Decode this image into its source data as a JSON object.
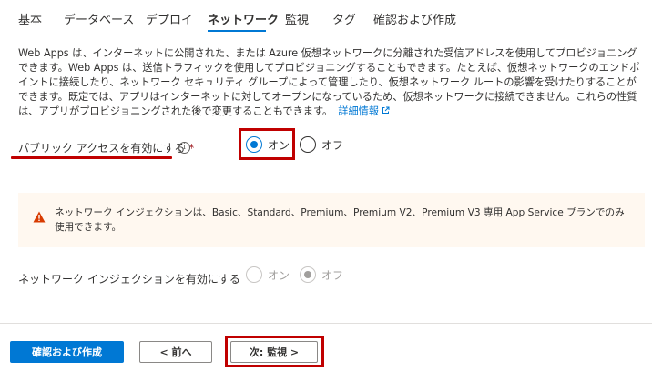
{
  "tabs": [
    {
      "label": "基本"
    },
    {
      "label": "データベース"
    },
    {
      "label": "デプロイ"
    },
    {
      "label": "ネットワーク",
      "active": true
    },
    {
      "label": "監視"
    },
    {
      "label": "タグ"
    },
    {
      "label": "確認および作成"
    }
  ],
  "description": {
    "text": "Web Apps は、インターネットに公開された、または Azure 仮想ネットワークに分離された受信アドレスを使用してプロビジョニングできます。Web Apps は、送信トラフィックを使用してプロビジョニングすることもできます。たとえば、仮想ネットワークのエンドポイントに接続したり、ネットワーク セキュリティ グループによって管理したり、仮想ネットワーク ルートの影響を受けたりすることができます。既定では、アプリはインターネットに対してオープンになっているため、仮想ネットワークに接続できません。これらの性質は、アプリがプロビジョニングされた後で変更することもできます。",
    "link": "詳細情報"
  },
  "public_access": {
    "label": "パブリック アクセスを有効にする",
    "required_mark": "*",
    "info_icon": "info-icon",
    "options": [
      {
        "label": "オン",
        "checked": true
      },
      {
        "label": "オフ",
        "checked": false
      }
    ]
  },
  "warning": {
    "icon": "warning-icon",
    "text": "ネットワーク インジェクションは、Basic、Standard、Premium、Premium V2、Premium V3 専用 App Service プランでのみ使用できます。"
  },
  "network_injection": {
    "label": "ネットワーク インジェクションを有効にする",
    "disabled": true,
    "options": [
      {
        "label": "オン",
        "checked": false
      },
      {
        "label": "オフ",
        "checked": true
      }
    ]
  },
  "footer": {
    "review_create": "確認および作成",
    "previous": "< 前へ",
    "next": "次: 監視 >"
  },
  "colors": {
    "accent": "#0078d4",
    "highlight": "#c00000",
    "warning": "#d83b01"
  }
}
